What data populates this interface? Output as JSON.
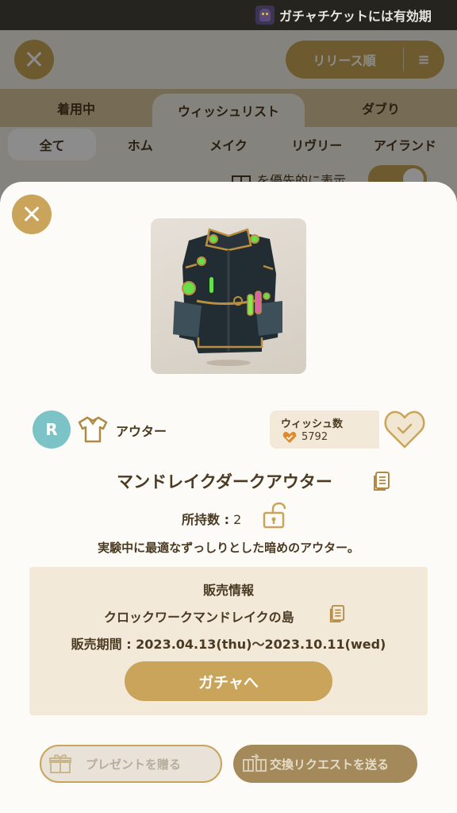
{
  "ticker": {
    "text": "ガチャチケットには有効期"
  },
  "background": {
    "sort_label": "リリース順",
    "tabs_primary": [
      "着用中",
      "ウィッシュリスト",
      "ダブり"
    ],
    "tabs_secondary": [
      "全て",
      "ホム",
      "メイク",
      "リヴリー",
      "アイランド"
    ],
    "priority_label": "を優先的に表示"
  },
  "item": {
    "rarity": "R",
    "type_label": "アウター",
    "name": "マンドレイクダークアウター",
    "owned_label": "所持数 :",
    "owned_count": "2",
    "description": "実験中に最適なずっしりとした暗めのアウター。"
  },
  "wishlist": {
    "label": "ウィッシュ数",
    "count": "5792"
  },
  "sale": {
    "title": "販売情報",
    "island": "クロックワークマンドレイクの島",
    "period": "販売期間 : 2023.04.13(thu)〜2023.10.11(wed)",
    "gacha_button": "ガチャへ"
  },
  "actions": {
    "present_button": "プレゼントを贈る",
    "trade_button": "交換リクエストを送る"
  },
  "colors": {
    "gold": "#c9a45a",
    "teal": "#7cc3c7",
    "text": "#4a3a22",
    "panel": "#f3e9d8"
  }
}
